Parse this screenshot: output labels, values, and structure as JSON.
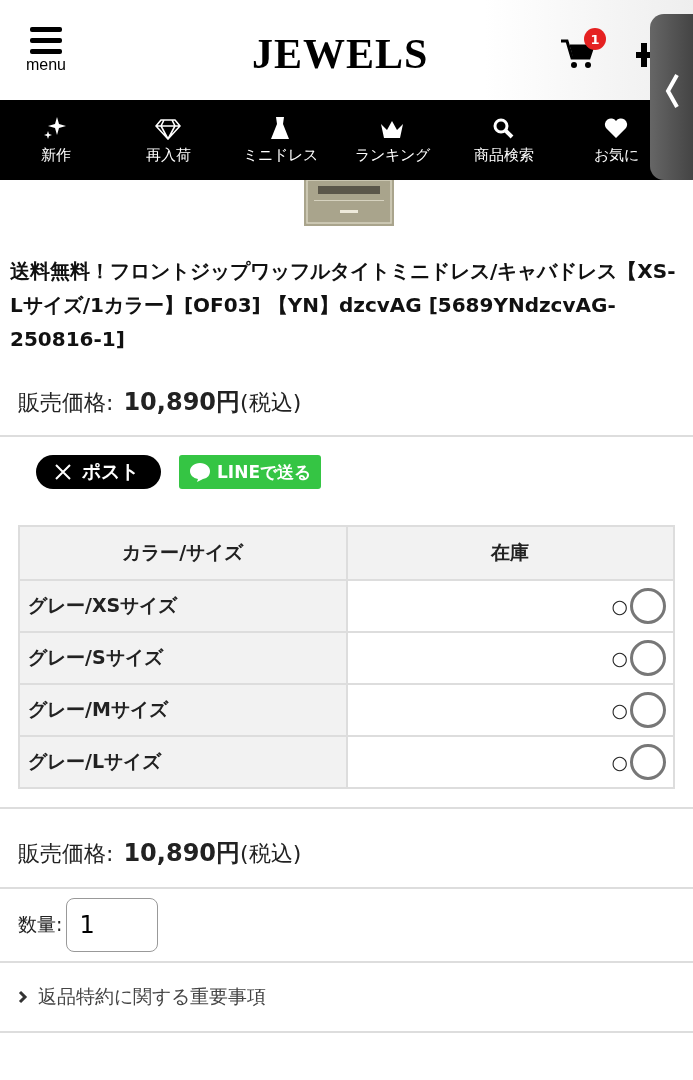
{
  "header": {
    "menu_label": "menu",
    "logo": "JEWELS",
    "cart_count": "1"
  },
  "nav": [
    {
      "label": "新作"
    },
    {
      "label": "再入荷"
    },
    {
      "label": "ミニドレス"
    },
    {
      "label": "ランキング"
    },
    {
      "label": "商品検索"
    },
    {
      "label": "お気に"
    }
  ],
  "product": {
    "title": "送料無料！フロントジップワッフルタイトミニドレス/キャバドレス【XS-Lサイズ/1カラー】[OF03] 【YN】dzcvAG [5689YNdzcvAG-250816-1]",
    "price_label": "販売価格:",
    "price": "10,890円",
    "tax": "(税込)"
  },
  "share": {
    "x_label": "ポスト",
    "line_label": "LINEで送る"
  },
  "stock_table": {
    "columns": [
      "カラー/サイズ",
      "在庫"
    ],
    "rows": [
      {
        "variant": "グレー/XSサイズ",
        "stock": "○",
        "selected": false
      },
      {
        "variant": "グレー/Sサイズ",
        "stock": "○",
        "selected": false
      },
      {
        "variant": "グレー/Mサイズ",
        "stock": "○",
        "selected": false
      },
      {
        "variant": "グレー/Lサイズ",
        "stock": "○",
        "selected": false
      }
    ]
  },
  "price2": {
    "price_label": "販売価格:",
    "price": "10,890円",
    "tax": "(税込)"
  },
  "quantity": {
    "label": "数量:",
    "value": "1"
  },
  "return_policy": {
    "label": "返品特約に関する重要事項"
  }
}
